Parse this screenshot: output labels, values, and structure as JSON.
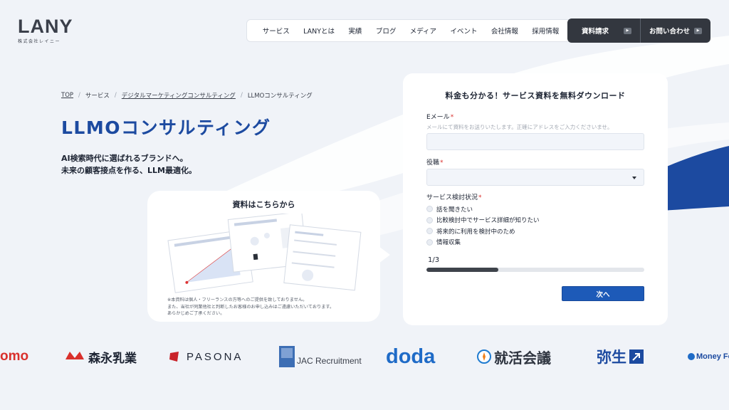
{
  "brand": {
    "logo": "LANY",
    "logo_sub": "株式会社レイニー"
  },
  "nav": {
    "items": [
      "サービス",
      "LANYとは",
      "実績",
      "ブログ",
      "メディア",
      "イベント",
      "会社情報",
      "採用情報"
    ],
    "cta_request": "資料請求",
    "cta_contact": "お問い合わせ"
  },
  "breadcrumb": [
    "TOP",
    "サービス",
    "デジタルマーケティングコンサルティング",
    "LLMOコンサルティング"
  ],
  "hero": {
    "title": "LLMOコンサルティング",
    "lead_line1": "AI検索時代に選ばれるブランドへ。",
    "lead_line2": "未来の顧客接点を作る、LLM最適化。"
  },
  "download_card": {
    "title": "資料はこちらから",
    "note_line1": "※本資料は個人・フリーランスの方等へのご提供を致しておりません。",
    "note_line2": "また、当社が同業他社と判断したお客様のお申し込みはご遠慮いただいております。",
    "note_line3": "あらかじめご了承ください。"
  },
  "form": {
    "title": "料金も分かる！サービス資料を無料ダウンロード",
    "email_label": "Eメール",
    "email_placeholder": "メールにて資料をお送りいたします。正確にアドレスをご入力くださいませ。",
    "role_label": "役職",
    "role_value": "",
    "status_label": "サービス検討状況",
    "status_options": [
      "話を聞きたい",
      "比較検討中でサービス詳細が知りたい",
      "将来的に利用を検討中のため",
      "情報収集"
    ],
    "step_text": "1/3",
    "progress": 0.33,
    "next_label": "次へ"
  },
  "client_logos": [
    "omo",
    "森永乳業",
    "PASONA",
    "JAC Recruitment",
    "doda",
    "就活会議",
    "弥生",
    "Money For"
  ],
  "colors": {
    "accent_blue": "#1c4aa0",
    "button_blue": "#1d5ab8",
    "dark": "#33373f",
    "background": "#f0f3f8",
    "required": "#d9302c"
  }
}
